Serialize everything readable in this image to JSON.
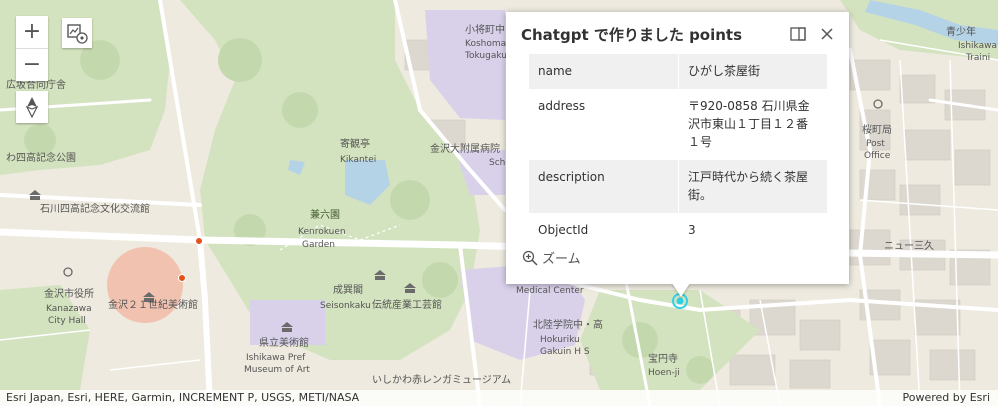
{
  "map": {
    "labels": {
      "kenrokuen_jp": "兼六園",
      "kenrokuen_en": "Kenrokuen",
      "kenrokuen_en2": "Garden",
      "kikantei_jp": "寄観亭",
      "kikantei_en": "Kikantei",
      "seisonkaku_jp": "成巽閣",
      "seisonkaku_en": "Seisonkaku",
      "densan_jp": "伝統産業工芸館",
      "museum_jp": "県立美術館",
      "museum_en1": "Ishikawa Pref",
      "museum_en2": "Museum of Art",
      "cityhall_jp": "金沢市役所",
      "cityhall_en1": "Kanazawa",
      "cityhall_en2": "City Hall",
      "museum21": "金沢２１世紀美術館",
      "shiinoki": "石川四高記念文化交流館",
      "kinen_park": "わ四高記念公園",
      "hirosaka": "広坂合同庁舎",
      "univ_jp": "金沢大附属病院",
      "hokuriku_jp": "北陸学院中・高",
      "hokuriku_en1": "Hokuriku",
      "hokuriku_en2": "Gakuin H S",
      "hosenji_jp": "宝円寺",
      "hosenji_en": "Hoen-ji",
      "medical": "Medical Center",
      "renga": "いしかわ赤レンガミュージアム",
      "kosho_jp": "小将町中",
      "kosho_en1": "Koshoma",
      "kosho_en2": "Tokugaku",
      "post_jp": "桜町局",
      "post_en1": "Post",
      "post_en2": "Office",
      "nyu_jp": "ニュー三久",
      "aoshonen_jp": "青少年",
      "aoshonen_en1": "Ishikawa",
      "aoshonen_en2": "Traini",
      "schoolfrag": "Sch"
    },
    "colors": {
      "base": "#eeeadf",
      "park": "#d4e3bf",
      "water": "#b5d3e6",
      "institution": "#d9d1ea",
      "road": "#ffffff",
      "building": "#d9d6cf"
    },
    "feature_marker_color": "#2fd0e6",
    "poi_marker_color": "#e4511b"
  },
  "controls": {
    "zoom_in": "+",
    "zoom_out": "−",
    "compass_icon": "compass-icon",
    "overview_icon": "basemap-toggle-icon"
  },
  "popup": {
    "title": "Chatgpt で作りました points",
    "dock_icon": "dock-icon",
    "close_icon": "close-icon",
    "rows": [
      {
        "key": "name",
        "value": "ひがし茶屋街"
      },
      {
        "key": "address",
        "value": "〒920-0858 石川県金沢市東山１丁目１２番１号"
      },
      {
        "key": "description",
        "value": "江戸時代から続く茶屋街。"
      },
      {
        "key": "ObjectId",
        "value": "3"
      }
    ],
    "zoom_label": "ズーム",
    "zoom_icon": "zoom-in-icon"
  },
  "attribution": {
    "text": "Esri Japan, Esri, HERE, Garmin, INCREMENT P, USGS, METI/NASA",
    "powered": "Powered by Esri"
  }
}
